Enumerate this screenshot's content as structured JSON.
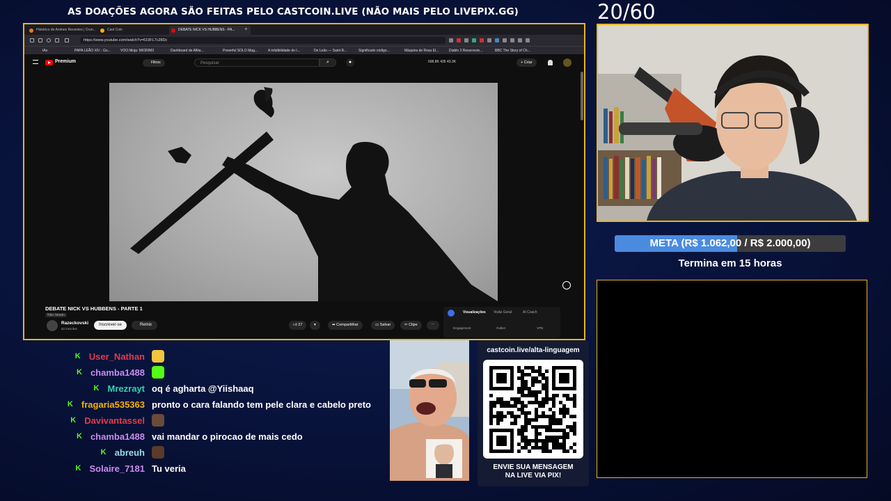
{
  "banner": "AS DOAÇÕES AGORA SÃO FEITAS PELO CASTCOIN.LIVE (NÃO MAIS PELO LIVEPIX.GG)",
  "counter": "20/60",
  "browser": {
    "tabs": [
      {
        "label": "Histórico de Animes Recentes | Crun...",
        "color": "#f47521"
      },
      {
        "label": "Cast Coin",
        "color": "#f5b400"
      },
      {
        "label": "DEBATE NICK VS HUBBENS - PA...",
        "color": "#ff0000"
      }
    ],
    "new_tab": "+",
    "url": "https://www.youtube.com/watch?v=619FL7c28Dc",
    "bookmarks": [
      "IAs",
      "PAPA LEÃO XIV - Go...",
      "VOO.Ninja: MIORIM3",
      "Dashboard de Afilia...",
      "Powerful SOLO Mag...",
      "A infalibilidade do I...",
      "De Leão — Saint R...",
      "Significado código...",
      "Máquina de Rosa El...",
      "Diablo 2 Resurrecte...",
      "BBC The Story of Ch..."
    ]
  },
  "youtube": {
    "logo": "Premium",
    "filters": "Filtros",
    "search_placeholder": "Pesquisar",
    "stats": "698.8K  435  43.3K",
    "create": "+ Criar",
    "video_title": "DEBATE NICK VS HUBBENS - PARTE 1",
    "badge": "Não listado",
    "channel": "Razeckovski",
    "subscribers": "52 inscritos",
    "subscribe": "Inscrever-se",
    "remix": "Remix",
    "likes": "27",
    "share": "Compartilhar",
    "save": "Salvar",
    "clip": "Clipe",
    "panel_tabs": [
      "Visualizações",
      "Visão Geral",
      "AI Coach"
    ],
    "panel_sub": [
      "Engagement",
      "Outlier",
      "VPN"
    ]
  },
  "goal": {
    "text": "META (R$ 1.062,00 / R$ 2.000,00)",
    "progress": 0.531,
    "ends": "Termina em 15 horas"
  },
  "chat": [
    {
      "user": "User_Nathan",
      "color": "#e23b4a",
      "msg": "",
      "emote_color": "#f2c53d"
    },
    {
      "user": "chamba1488",
      "color": "#c98bf0",
      "msg": "",
      "emote_color": "#53fc18"
    },
    {
      "user": "Mrezrayt",
      "color": "#2ed3b0",
      "msg": "oq é agharta @Yiishaaq",
      "emote_color": ""
    },
    {
      "user": "fragaria535363",
      "color": "#f2b400",
      "msg": "pronto o cara falando tem pele clara e cabelo preto",
      "emote_color": ""
    },
    {
      "user": "Davivantassel",
      "color": "#e23b4a",
      "msg": "",
      "emote_color": "#6b4a3a"
    },
    {
      "user": "chamba1488",
      "color": "#c98bf0",
      "msg": "vai mandar o pirocao de mais cedo",
      "emote_color": ""
    },
    {
      "user": "abreuh",
      "color": "#9adbe8",
      "msg": "",
      "emote_color": "#5a3a2a"
    },
    {
      "user": "Solaire_7181",
      "color": "#c98bf0",
      "msg": "Tu veria",
      "emote_color": ""
    }
  ],
  "qr": {
    "url": "castcoin.live/alta-linguagem",
    "message_line1": "ENVIE SUA MENSAGEM",
    "message_line2": "NA LIVE VIA PIX!"
  },
  "icons": [
    "youtube-logo-icon",
    "search-icon",
    "mic-icon",
    "bell-icon",
    "kick-icon",
    "qr-code-icon"
  ]
}
